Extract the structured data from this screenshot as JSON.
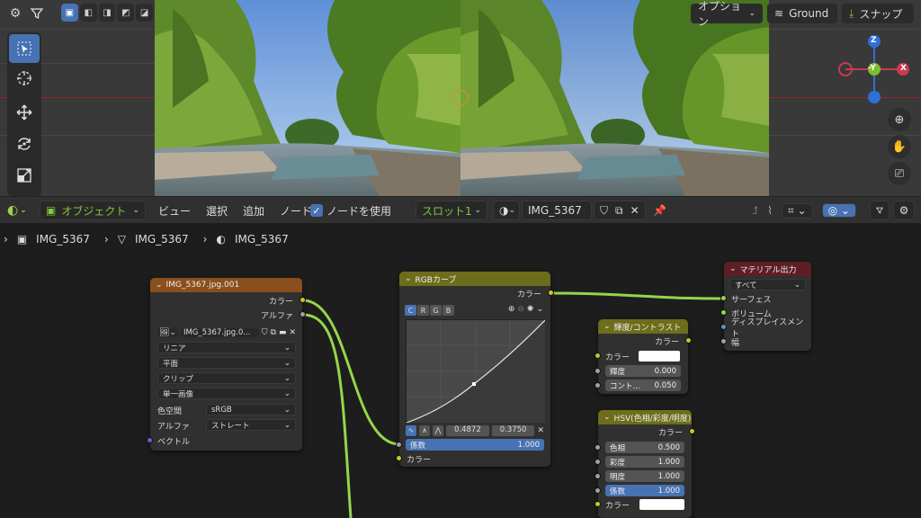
{
  "viewport": {
    "options_label": "オプション",
    "ground_label": "Ground",
    "snap_label": "スナップ",
    "gizmo": {
      "z": "Z",
      "y": "-Y",
      "x": "X"
    }
  },
  "header": {
    "mode": "オブジェクト",
    "menus": [
      "ビュー",
      "選択",
      "追加",
      "ノード"
    ],
    "use_nodes": "ノードを使用",
    "slot": "スロット1",
    "material": "IMG_5367"
  },
  "breadcrumb": [
    "IMG_5367",
    "IMG_5367",
    "IMG_5367"
  ],
  "image_node": {
    "title": "IMG_5367.jpg.001",
    "out_color": "カラー",
    "out_alpha": "アルファ",
    "image_name": "IMG_5367.jpg.0...",
    "interpolation": "リニア",
    "projection": "平面",
    "extension": "クリップ",
    "source": "単一画像",
    "colorspace_label": "色空間",
    "colorspace": "sRGB",
    "alpha_label": "アルファ",
    "alpha_mode": "ストレート",
    "vector": "ベクトル"
  },
  "rgb_node": {
    "title": "RGBカーブ",
    "out_color": "カラー",
    "channels": [
      "C",
      "R",
      "G",
      "B"
    ],
    "point_x": "0.4872",
    "point_y": "0.3750",
    "factor_label": "係数",
    "factor_value": "1.000",
    "in_color": "カラー"
  },
  "bc_node": {
    "title": "輝度/コントラスト",
    "out_color": "カラー",
    "in_color": "カラー",
    "bright_label": "輝度",
    "bright_value": "0.000",
    "contrast_label": "コント...",
    "contrast_value": "0.050"
  },
  "hsv_node": {
    "title": "HSV(色相/彩度/明度)",
    "out_color": "カラー",
    "hue_label": "色相",
    "hue_value": "0.500",
    "sat_label": "彩度",
    "sat_value": "1.000",
    "val_label": "明度",
    "val_value": "1.000",
    "fac_label": "係数",
    "fac_value": "1.000",
    "in_color": "カラー"
  },
  "output_node": {
    "title": "マテリアル出力",
    "target": "すべて",
    "surface": "サーフェス",
    "volume": "ボリューム",
    "displacement": "ディスプレイスメント",
    "thickness": "幅"
  },
  "colors": {
    "accent": "#4772b3",
    "link": "#96d44a",
    "image_header": "#8a4f1c",
    "color_header": "#6d6d1b",
    "output_header": "#5e1e25"
  }
}
